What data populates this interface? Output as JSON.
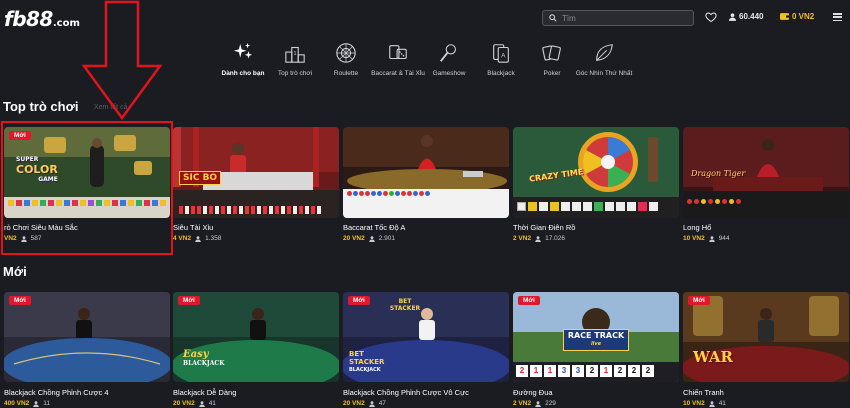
{
  "header": {
    "logo_main": "fb88",
    "logo_suffix": ".com",
    "search_placeholder": "Tìm",
    "user_count": "60.440",
    "balance": "0 VN2"
  },
  "categories": [
    {
      "label": "Dành cho bạn",
      "icon": "sparkle-icon",
      "active": true
    },
    {
      "label": "Top trò chơi",
      "icon": "podium-icon"
    },
    {
      "label": "Roulette",
      "icon": "roulette-wheel-icon"
    },
    {
      "label": "Baccarat & Tài Xỉu",
      "icon": "dice-cards-icon"
    },
    {
      "label": "Gameshow",
      "icon": "microphone-icon"
    },
    {
      "label": "Blackjack",
      "icon": "playing-cards-icon"
    },
    {
      "label": "Poker",
      "icon": "poker-cards-icon"
    },
    {
      "label": "Góc Nhìn Thứ Nhất",
      "icon": "leaf-icon"
    }
  ],
  "sections": {
    "top_games": {
      "title": "Top trò chơi",
      "see_all": "Xem tất cả",
      "badge": "Mới",
      "cards": [
        {
          "title": "rò Chơi Siêu Màu Sắc",
          "price": "VN2",
          "players": "587",
          "badge": true
        },
        {
          "title": "Siêu Tài Xỉu",
          "price": "4 VN2",
          "players": "1.358"
        },
        {
          "title": "Baccarat Tốc Độ A",
          "price": "20 VN2",
          "players": "2.901"
        },
        {
          "title": "Thời Gian Điên Rồ",
          "price": "2 VN2",
          "players": "17.026"
        },
        {
          "title": "Long Hổ",
          "price": "10 VN2",
          "players": "944"
        }
      ]
    },
    "new_games": {
      "title": "Mới",
      "badge": "Mới",
      "cards": [
        {
          "title": "Blackjack Chồng Phỉnh Cược 4",
          "price": "400 VN2",
          "players": "11"
        },
        {
          "title": "Blackjack Dễ Dàng",
          "price": "20 VN2",
          "players": "41"
        },
        {
          "title": "Blackjack Chồng Phỉnh Cược Vô Cực",
          "price": "20 VN2",
          "players": "47"
        },
        {
          "title": "Đường Đua",
          "price": "2 VN2",
          "players": "229"
        },
        {
          "title": "Chiến Tranh",
          "price": "10 VN2",
          "players": "41"
        }
      ]
    }
  },
  "thumb_text": {
    "color_game_super": "SUPER",
    "color_game_word": "COLOR",
    "color_game_sub": "GAME",
    "sicbo": "SIC BO",
    "crazy_time": "CRAZY TIME",
    "dragon_tiger": "Dragon Tiger",
    "easy": "Easy",
    "blackjack": "BLACKJACK",
    "bet_stacker": "BET STACKER",
    "race_track": "RACE TRACK",
    "race_live": "live",
    "war": "WAR",
    "race_numbers": [
      "2",
      "1",
      "1",
      "3",
      "3",
      "2",
      "1",
      "2",
      "2",
      "2"
    ]
  },
  "colors": {
    "background": "#1b1c22",
    "accent_gold": "#f2c01b",
    "badge_red": "#e0182d",
    "highlight_red": "#e0141b"
  }
}
